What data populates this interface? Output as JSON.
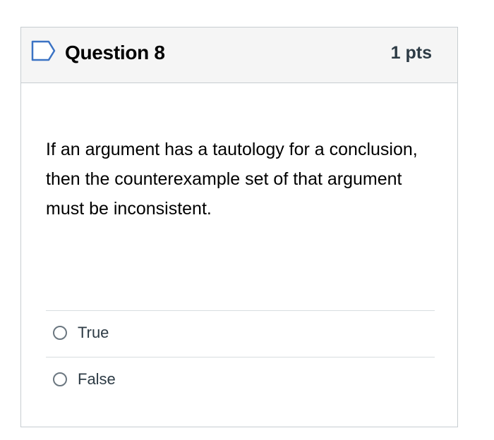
{
  "question": {
    "title": "Question 8",
    "points": "1 pts",
    "flag_icon": "flag-bookmark-icon",
    "text": "If an argument has a tautology for a conclusion, then the counterexample set of that argument must be inconsistent."
  },
  "answers": [
    {
      "label": "True",
      "selected": false
    },
    {
      "label": "False",
      "selected": false
    }
  ],
  "colors": {
    "header_bg": "#f5f5f5",
    "border": "#c7cdd1",
    "flag_stroke": "#3b73c4"
  }
}
